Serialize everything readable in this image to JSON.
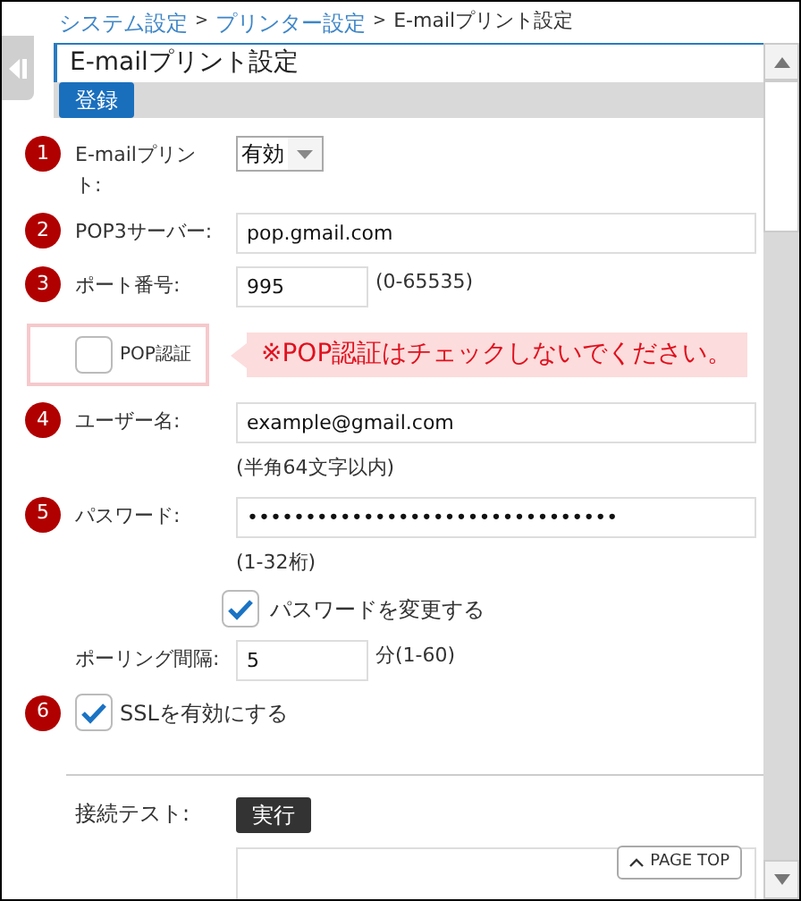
{
  "breadcrumb": {
    "separator": ">",
    "items": [
      {
        "label": "システム設定",
        "kind": "link"
      },
      {
        "label": "プリンター設定",
        "kind": "link"
      },
      {
        "label": "E-mailプリント設定",
        "kind": "current"
      }
    ]
  },
  "panel": {
    "title": "E-mailプリント設定",
    "save_button": "登録"
  },
  "rows": [
    {
      "kind": "select",
      "badge": "1",
      "label": "E-mailプリント:",
      "value": "有効"
    },
    {
      "kind": "text",
      "badge": "2",
      "label": "POP3サーバー:",
      "value": "pop.gmail.com"
    },
    {
      "kind": "short-text",
      "badge": "3",
      "label": "ポート番号:",
      "value": "995",
      "suffix": "(0-65535)"
    },
    {
      "kind": "pop-auth",
      "label": "POP認証",
      "checked": false,
      "note": "※POP認証はチェックしないでください。"
    },
    {
      "kind": "text",
      "badge": "4",
      "label": "ユーザー名:",
      "value": "example@gmail.com",
      "hint": "(半角64文字以内)"
    },
    {
      "kind": "text",
      "badge": "5",
      "label": "パスワード:",
      "value": "••••••••••••••••••••••••••••••••",
      "hint": "(1-32桁)"
    },
    {
      "kind": "checkbox",
      "label": "パスワードを変更する",
      "checked": true
    },
    {
      "kind": "short-text",
      "label": "ポーリング間隔:",
      "value": "5",
      "suffix": "分(1-60)"
    },
    {
      "kind": "wide-checkbox",
      "badge": "6",
      "label": "SSLを有効にする",
      "checked": true
    }
  ],
  "connection_test": {
    "label": "接続テスト:",
    "button": "実行"
  },
  "page_top": "PAGE TOP"
}
